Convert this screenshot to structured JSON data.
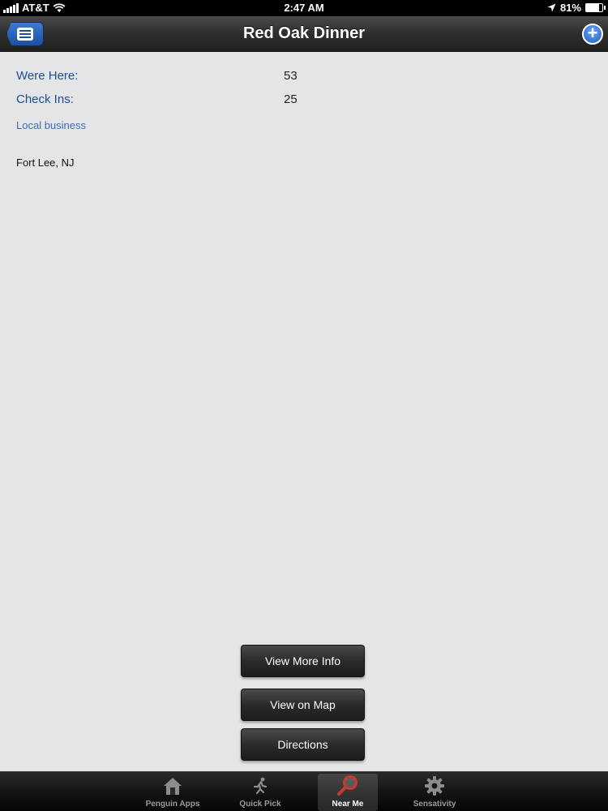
{
  "status_bar": {
    "carrier": "AT&T",
    "time": "2:47 AM",
    "battery_text": "81%",
    "battery_level": 0.81
  },
  "nav": {
    "title": "Red Oak Dinner"
  },
  "info": {
    "were_here_label": "Were Here:",
    "were_here_value": "53",
    "check_ins_label": "Check Ins:",
    "check_ins_value": "25",
    "category": "Local business",
    "location": "Fort Lee, NJ"
  },
  "actions": {
    "more_info": "View More Info",
    "view_map": "View on Map",
    "directions": "Directions"
  },
  "tabs": [
    {
      "label": "Penguin Apps",
      "icon": "house-icon"
    },
    {
      "label": "Quick Pick",
      "icon": "runner-icon"
    },
    {
      "label": "Near Me",
      "icon": "magnifier-icon",
      "active": true
    },
    {
      "label": "Sensativity",
      "icon": "gear-icon"
    }
  ],
  "colors": {
    "label_blue": "#1d4f8e",
    "category_blue": "#3d6fae",
    "nav_button_blue": "#1c4f9e"
  }
}
